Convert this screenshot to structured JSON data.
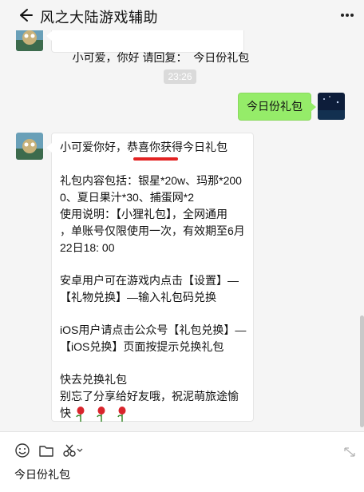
{
  "header": {
    "title": "风之大陆游戏辅助"
  },
  "messages": {
    "top_partial": "小可爱，你好 请回复：  今日份礼包",
    "timestamp": "23:26",
    "me": "今日份礼包",
    "gift": {
      "line1": "小可爱你好，恭喜你获得今日礼包",
      "line2": "礼包内容包括：银星*20w、玛那*200",
      "line3": "0、夏日果汁*30、捕蛋网*2",
      "line4": "使用说明：【小狸礼包】，全网通用",
      "line5": "，单账号仅限使用一次，有效期至6月",
      "line6": "22日18: 00",
      "line7": "安卓用户可在游戏内点击【设置】—",
      "line8": "【礼物兑换】—输入礼包码兑换",
      "line9": "iOS用户请点击公众号【礼包兑换】—",
      "line10": "【iOS兑换】页面按提示兑换礼包",
      "line11": "快去兑换礼包",
      "line12": "别忘了分享给好友哦，祝泥萌旅途愉",
      "line13": "快"
    }
  },
  "footer": {
    "input_value": "今日份礼包"
  },
  "icons": [
    "back-arrow-icon",
    "more-icon",
    "emoji-icon",
    "folder-icon",
    "scissors-icon",
    "expand-icon",
    "rose-icon"
  ],
  "colors": {
    "my_bubble": "#95ec69",
    "redaction": "#e32222"
  }
}
